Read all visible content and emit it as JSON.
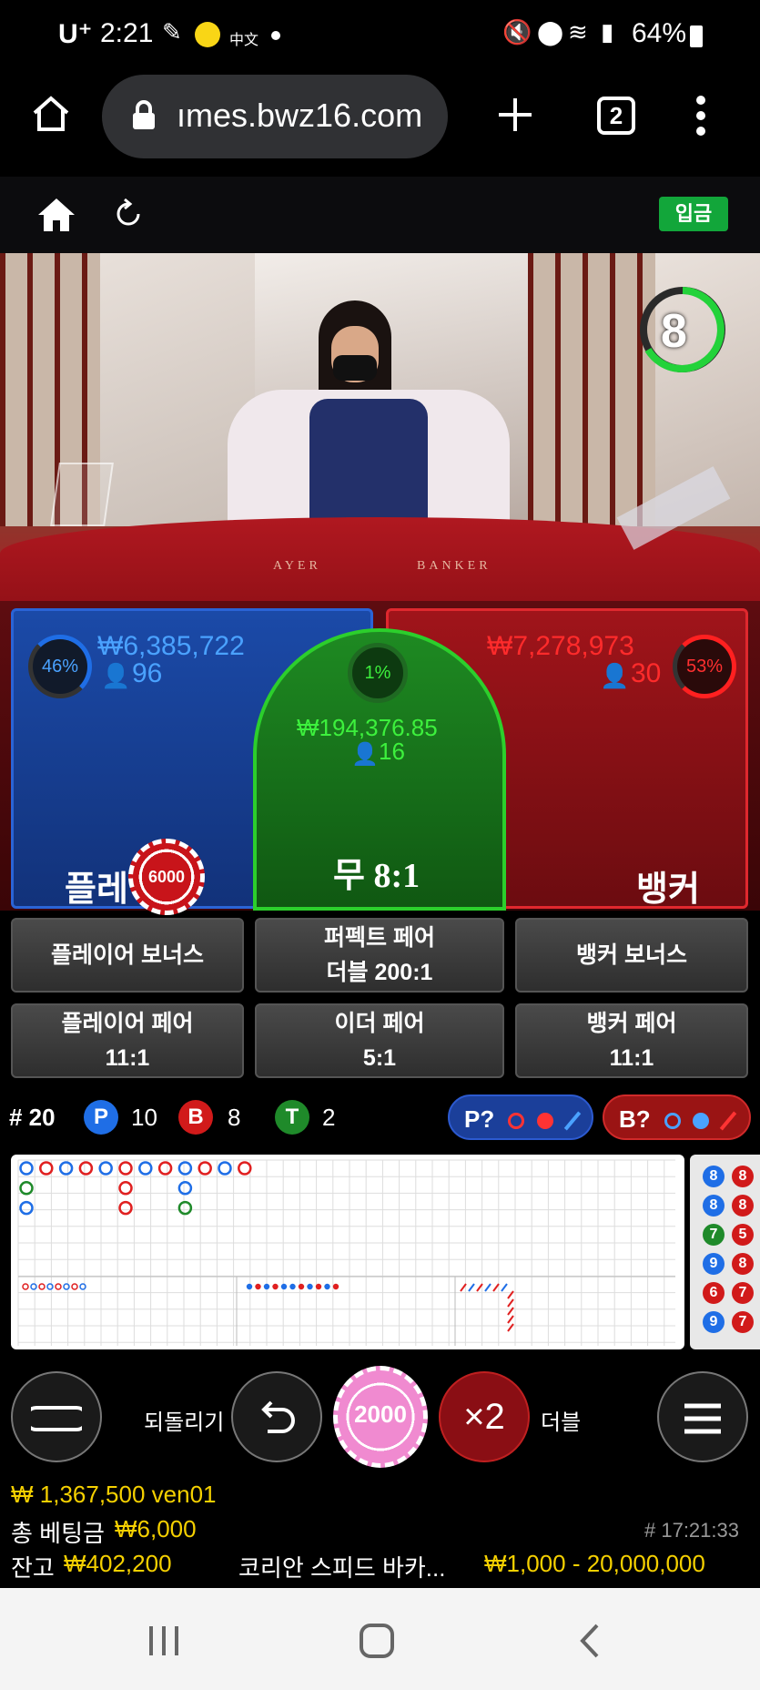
{
  "status_bar": {
    "carrier": "U⁺",
    "time": "2:21",
    "battery": "64%",
    "chinese_icon_text": "中文"
  },
  "browser": {
    "url": "ımes.bwz16.com",
    "tab_count": "2"
  },
  "site_nav": {
    "deposit_label": "입금"
  },
  "video": {
    "countdown": "8",
    "table_text_left": "AYER",
    "table_text_right": "BANKER"
  },
  "board": {
    "player": {
      "percent": "46%",
      "amount": "₩6,385,722",
      "bettors": "96",
      "label": "플레이어"
    },
    "tie": {
      "percent": "1%",
      "amount": "₩194,376.85",
      "bettors": "16",
      "label": "무 8:1"
    },
    "banker": {
      "percent": "53%",
      "amount": "₩7,278,973",
      "bettors": "30",
      "label": "뱅커"
    },
    "player_chip": "6000"
  },
  "side_bets": [
    {
      "line1": "플레이어 보너스",
      "line2": ""
    },
    {
      "line1": "퍼펙트 페어",
      "line2": "더블 200:1"
    },
    {
      "line1": "뱅커 보너스",
      "line2": ""
    },
    {
      "line1": "플레이어 페어",
      "line2": "11:1"
    },
    {
      "line1": "이더 페어",
      "line2": "5:1"
    },
    {
      "line1": "뱅커 페어",
      "line2": "11:1"
    }
  ],
  "stats": {
    "round": "# 20",
    "player_label": "P",
    "player_count": "10",
    "banker_label": "B",
    "banker_count": "8",
    "tie_label": "T",
    "tie_count": "2",
    "player_predict": "P?",
    "banker_predict": "B?"
  },
  "road": {
    "side_numbers": [
      "8",
      "8",
      "7",
      "9",
      "6",
      "9"
    ],
    "side_numbers_2": [
      "8",
      "8",
      "5",
      "8",
      "7",
      "7"
    ]
  },
  "controls": {
    "undo_label": "되돌리기",
    "selected_chip": "2000",
    "double_symbol": "×2",
    "double_label": "더블"
  },
  "info": {
    "user_line": "₩ 1,367,500 ven01",
    "total_bet_label": "총 베팅금",
    "total_bet_value": "₩6,000",
    "round_time": "# 17:21:33",
    "balance_label": "잔고",
    "balance_value": "₩402,200",
    "table_name": "코리안 스피드 바카...",
    "limits": "₩1,000 - 20,000,000"
  },
  "colors": {
    "player_blue": "#1b4aa8",
    "banker_red": "#a0141a",
    "tie_green": "#1e8a22",
    "deposit_green": "#12a63a",
    "gold": "#f5d000"
  }
}
